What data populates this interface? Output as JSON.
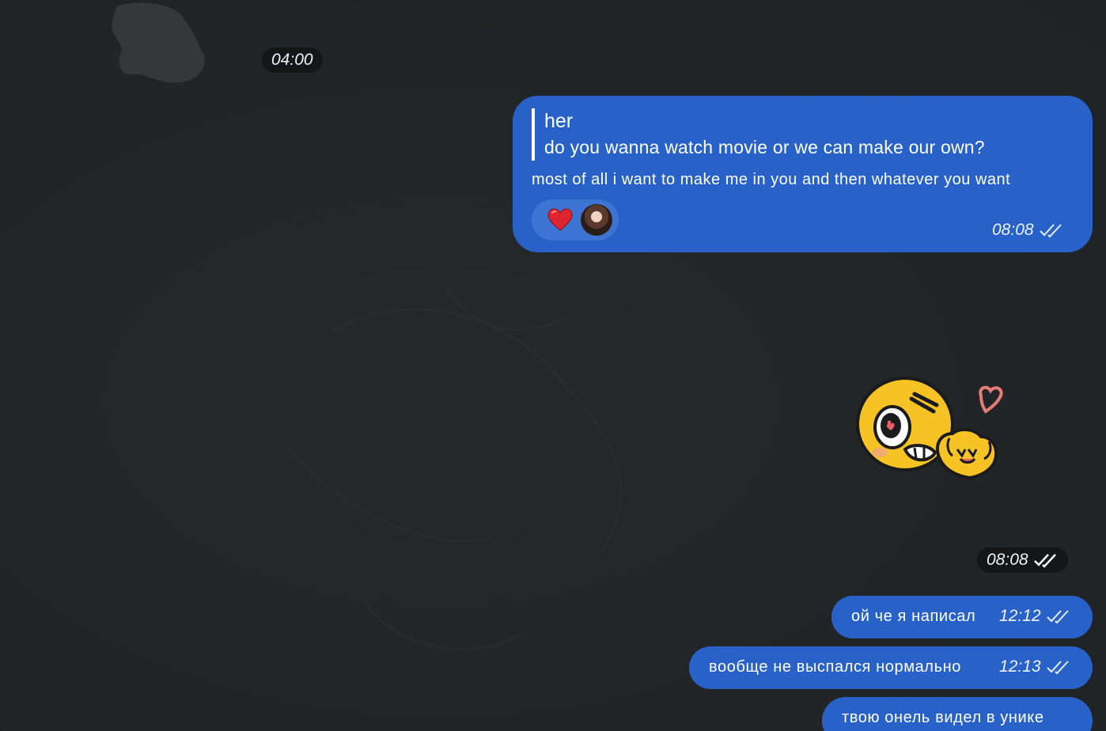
{
  "date_separator": "04:00",
  "message_reply": {
    "quoted_author": "her",
    "quoted_text": "do you wanna watch movie or we can make our own?",
    "text": "most of all i want to make me in you and then whatever you want",
    "time": "08:08",
    "reaction": "heart",
    "status": "read"
  },
  "sticker": {
    "name": "yellow-smiley-finger-heart-sticker",
    "time": "08:08",
    "status": "read"
  },
  "messages": [
    {
      "text": "ой че я написал",
      "time": "12:12",
      "status": "read"
    },
    {
      "text": "вообще не выспался нормально",
      "time": "12:13",
      "status": "read"
    },
    {
      "text": "твою онель видел в унике"
    }
  ],
  "colors": {
    "background": "#232628",
    "bubble_outgoing": "#2862c9",
    "reaction_pill": "#3d74d3",
    "time_pill": "#141617"
  }
}
